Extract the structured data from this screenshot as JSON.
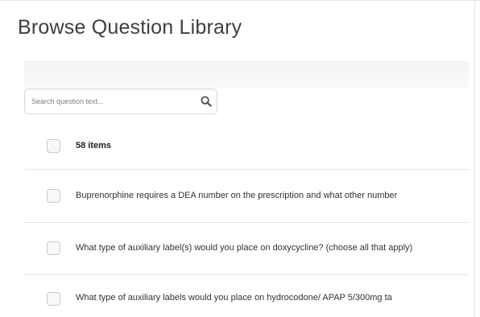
{
  "page": {
    "title": "Browse Question Library"
  },
  "search": {
    "placeholder": "Search question text...",
    "value": ""
  },
  "list": {
    "count_label": "58 items",
    "questions": [
      "Buprenorphine requires a DEA number on the prescription and what other number",
      "What type of auxiliary label(s) would you place on doxycycline? (choose all that apply)",
      "What type of auxiliary labels would you place on hydrocodone/ APAP 5/300mg ta"
    ]
  },
  "colors": {
    "title_text": "#3c3f44",
    "border": "#e3e5e7",
    "checkbox_border": "#c6c9ce"
  }
}
